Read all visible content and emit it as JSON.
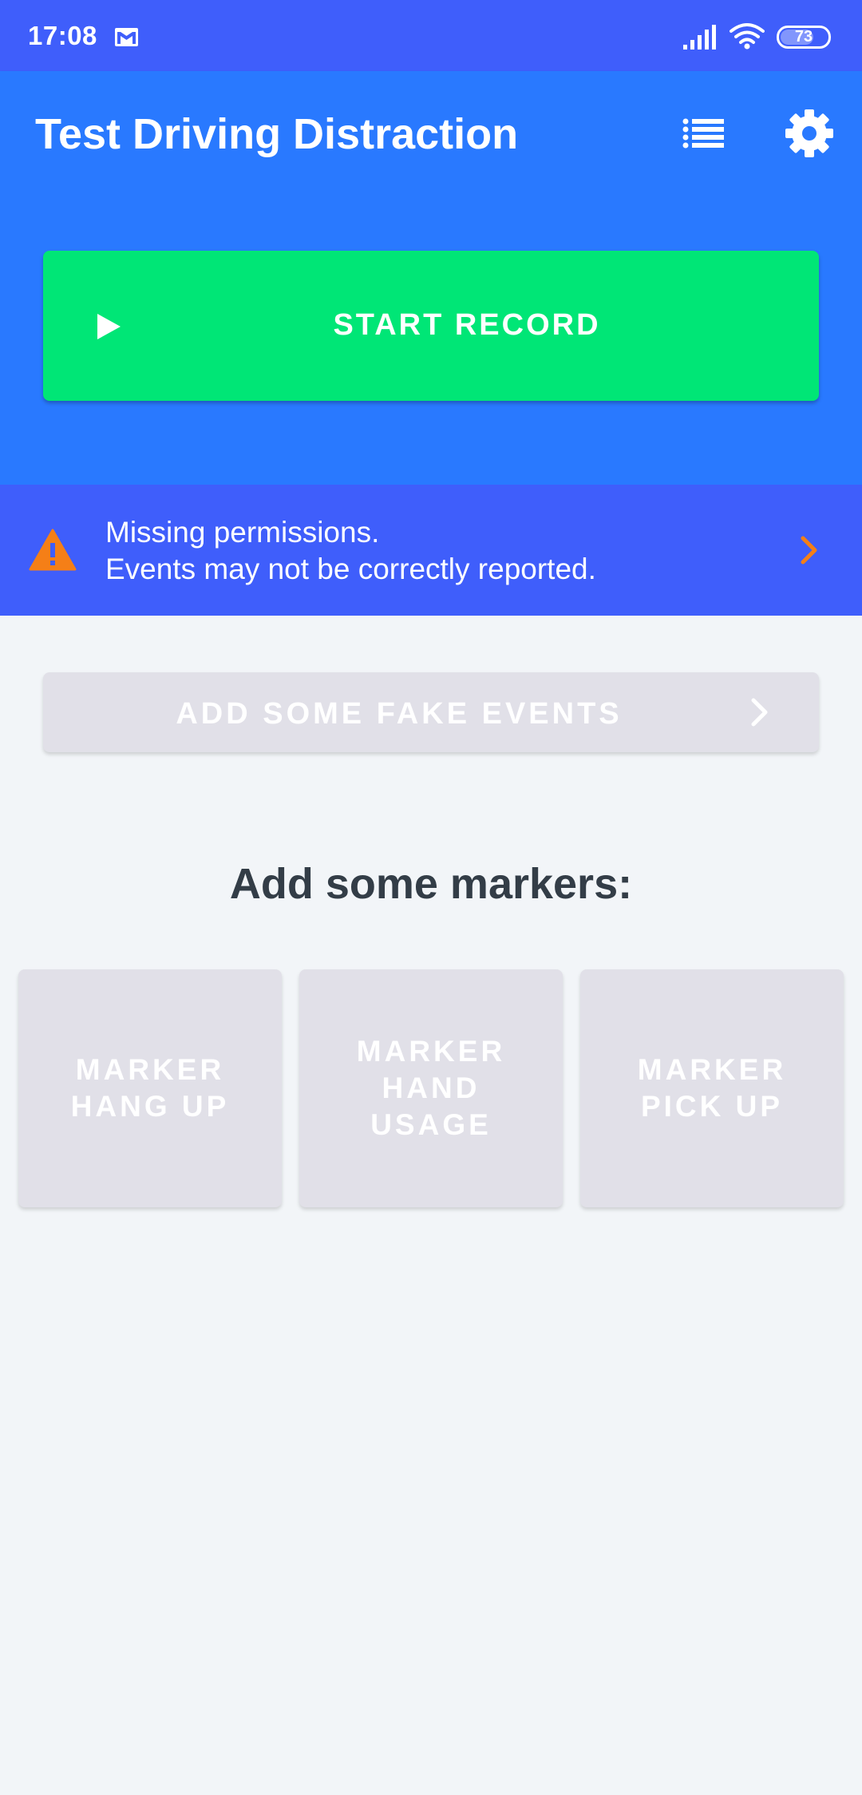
{
  "status_bar": {
    "time": "17:08",
    "battery": "73",
    "battery_level_percent": 73,
    "icons": [
      "gmail-icon",
      "signal-icon",
      "wifi-icon",
      "battery-icon"
    ]
  },
  "app_bar": {
    "title": "Test Driving Distraction",
    "icons": [
      "list-icon",
      "gear-icon"
    ]
  },
  "record": {
    "label": "START RECORD",
    "icon": "play-icon"
  },
  "permission_banner": {
    "line1": "Missing permissions.",
    "line2": "Events may not be correctly reported.",
    "icons": [
      "warning-icon",
      "chevron-right-icon"
    ]
  },
  "fake_events": {
    "label": "ADD SOME FAKE EVENTS",
    "icon": "chevron-right-icon"
  },
  "markers": {
    "title": "Add some markers:",
    "items": [
      {
        "label": "MARKER\nHANG UP"
      },
      {
        "label": "MARKER\nHAND\nUSAGE"
      },
      {
        "label": "MARKER\nPICK UP"
      }
    ]
  },
  "colors": {
    "status_bar": "#3f5efb",
    "app_bar": "#2979ff",
    "record_button": "#00e676",
    "banner": "#3f5efb",
    "warning": "#f57f17",
    "disabled_button": "#e1e0e8",
    "background": "#f2f5f8"
  }
}
